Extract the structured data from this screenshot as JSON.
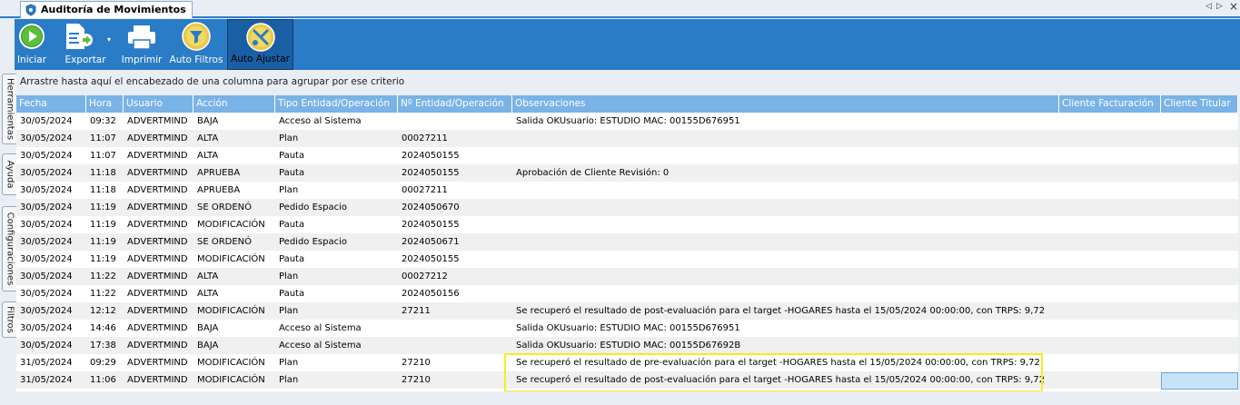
{
  "window": {
    "tab_title": "Auditoría de Movimientos",
    "nav_left": "◁",
    "nav_right": "▷",
    "close": "×"
  },
  "toolbar": {
    "buttons": [
      {
        "label": "Iniciar",
        "icon": "play-icon"
      },
      {
        "label": "Exportar",
        "icon": "export-icon"
      },
      {
        "label": "Imprimir",
        "icon": "printer-icon"
      },
      {
        "label": "Auto Filtros",
        "icon": "auto-filter-icon"
      },
      {
        "label": "Auto Ajustar",
        "icon": "auto-adjust-icon"
      }
    ]
  },
  "sidebar": {
    "tabs": [
      "Herramientas",
      "Ayuda",
      "Configuraciones",
      "Filtros"
    ]
  },
  "group_hint": "Arrastre hasta aquí el encabezado de una columna para agrupar por ese criterio",
  "grid": {
    "columns": [
      "Fecha",
      "Hora",
      "Usuario",
      "Acción",
      "Tipo Entidad/Operación",
      "Nº Entidad/Operación",
      "Observaciones",
      "Cliente Facturación",
      "Cliente Titular"
    ],
    "rows": [
      [
        "30/05/2024",
        "09:32",
        "ADVERTMIND",
        "BAJA",
        "Acceso al Sistema",
        "",
        "Salida OKUsuario: ESTUDIO MAC: 00155D676951",
        "",
        ""
      ],
      [
        "30/05/2024",
        "11:07",
        "ADVERTMIND",
        "ALTA",
        "Plan",
        "00027211",
        "",
        "",
        ""
      ],
      [
        "30/05/2024",
        "11:07",
        "ADVERTMIND",
        "ALTA",
        "Pauta",
        "2024050155",
        "",
        "",
        ""
      ],
      [
        "30/05/2024",
        "11:18",
        "ADVERTMIND",
        "APRUEBA",
        "Pauta",
        "2024050155",
        "Aprobación de Cliente Revisión: 0",
        "",
        ""
      ],
      [
        "30/05/2024",
        "11:18",
        "ADVERTMIND",
        "APRUEBA",
        "Plan",
        "00027211",
        "",
        "",
        ""
      ],
      [
        "30/05/2024",
        "11:19",
        "ADVERTMIND",
        "SE ORDENÓ",
        "Pedido Espacio",
        "2024050670",
        "",
        "",
        ""
      ],
      [
        "30/05/2024",
        "11:19",
        "ADVERTMIND",
        "MODIFICACIÓN",
        "Pauta",
        "2024050155",
        "",
        "",
        ""
      ],
      [
        "30/05/2024",
        "11:19",
        "ADVERTMIND",
        "SE ORDENÓ",
        "Pedido Espacio",
        "2024050671",
        "",
        "",
        ""
      ],
      [
        "30/05/2024",
        "11:19",
        "ADVERTMIND",
        "MODIFICACIÓN",
        "Pauta",
        "2024050155",
        "",
        "",
        ""
      ],
      [
        "30/05/2024",
        "11:22",
        "ADVERTMIND",
        "ALTA",
        "Plan",
        "00027212",
        "",
        "",
        ""
      ],
      [
        "30/05/2024",
        "11:22",
        "ADVERTMIND",
        "ALTA",
        "Pauta",
        "2024050156",
        "",
        "",
        ""
      ],
      [
        "30/05/2024",
        "12:12",
        "ADVERTMIND",
        "MODIFICACIÓN",
        "Plan",
        "27211",
        "Se recuperó el resultado de post-evaluación para el target -HOGARES hasta el 15/05/2024 00:00:00, con TRPS: 9,72",
        "",
        ""
      ],
      [
        "30/05/2024",
        "14:46",
        "ADVERTMIND",
        "BAJA",
        "Acceso al Sistema",
        "",
        "Salida OKUsuario: ESTUDIO MAC: 00155D676951",
        "",
        ""
      ],
      [
        "30/05/2024",
        "17:38",
        "ADVERTMIND",
        "BAJA",
        "Acceso al Sistema",
        "",
        "Salida OKUsuario: ESTUDIO MAC: 00155D67692B",
        "",
        ""
      ],
      [
        "31/05/2024",
        "09:29",
        "ADVERTMIND",
        "MODIFICACIÓN",
        "Plan",
        "27210",
        "Se recuperó el resultado de pre-evaluación para el target -HOGARES hasta el 15/05/2024 00:00:00, con TRPS: 9,72",
        "",
        ""
      ],
      [
        "31/05/2024",
        "11:06",
        "ADVERTMIND",
        "MODIFICACIÓN",
        "Plan",
        "27210",
        "Se recuperó el resultado de post-evaluación para el target -HOGARES hasta el 15/05/2024 00:00:00, con TRPS: 9,72",
        "",
        ""
      ]
    ]
  },
  "colors": {
    "toolbar": "#2a7cc7",
    "header": "#7ab3e6",
    "highlight": "#f4ee1a",
    "selected_cell": "#c7e4f7"
  }
}
